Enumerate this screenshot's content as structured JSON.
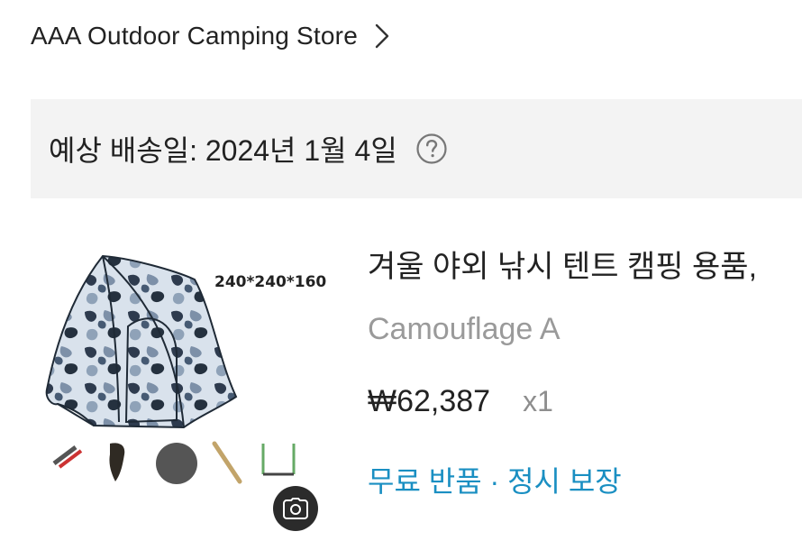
{
  "store": {
    "name": "AAA Outdoor Camping Store"
  },
  "delivery": {
    "text": "예상 배송일: 2024년 1월 4일"
  },
  "product": {
    "image_size_label": "240*240*160",
    "title": "겨울 야외 낚시 텐트 캠핑 용품,",
    "variant": "Camouflage A",
    "price": "₩62,387",
    "quantity": "x1",
    "return_policy": "무료 반품 · 정시 보장"
  },
  "icons": {
    "store_chevron": "chevron-right-icon",
    "help": "question-circle-icon",
    "camera": "camera-icon"
  },
  "colors": {
    "delivery_background": "#f3f3f3",
    "return_policy_link": "#1a8fc2",
    "muted_text": "#9a9a9a",
    "camera_button": "#2b2b2b"
  }
}
